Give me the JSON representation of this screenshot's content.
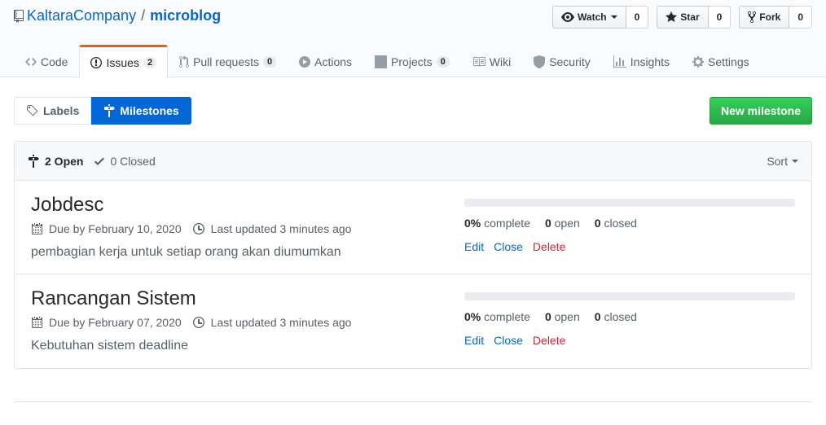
{
  "repo": {
    "owner": "KaltaraCompany",
    "separator": "/",
    "name": "microblog"
  },
  "actions": {
    "watch": {
      "label": "Watch",
      "count": "0"
    },
    "star": {
      "label": "Star",
      "count": "0"
    },
    "fork": {
      "label": "Fork",
      "count": "0"
    }
  },
  "nav": [
    {
      "label": "Code",
      "icon": "code-icon"
    },
    {
      "label": "Issues",
      "icon": "issue-icon",
      "counter": "2"
    },
    {
      "label": "Pull requests",
      "icon": "pull-request-icon",
      "counter": "0"
    },
    {
      "label": "Actions",
      "icon": "play-icon"
    },
    {
      "label": "Projects",
      "icon": "project-icon",
      "counter": "0"
    },
    {
      "label": "Wiki",
      "icon": "book-icon"
    },
    {
      "label": "Security",
      "icon": "shield-icon"
    },
    {
      "label": "Insights",
      "icon": "graph-icon"
    },
    {
      "label": "Settings",
      "icon": "gear-icon"
    }
  ],
  "subnav": {
    "labels": "Labels",
    "milestones": "Milestones"
  },
  "new_milestone": "New milestone",
  "filter": {
    "open": "2 Open",
    "closed": "0 Closed",
    "sort": "Sort"
  },
  "milestones": [
    {
      "title": "Jobdesc",
      "due": "Due by February 10, 2020",
      "updated": "Last updated 3 minutes ago",
      "description": "pembagian kerja untuk setiap orang akan diumumkan",
      "percent": "0%",
      "percent_label": "complete",
      "open": "0",
      "open_label": "open",
      "closed": "0",
      "closed_label": "closed",
      "progress": 0,
      "edit": "Edit",
      "close": "Close",
      "delete": "Delete"
    },
    {
      "title": "Rancangan Sistem",
      "due": "Due by February 07, 2020",
      "updated": "Last updated 3 minutes ago",
      "description": "Kebutuhan sistem deadline",
      "percent": "0%",
      "percent_label": "complete",
      "open": "0",
      "open_label": "open",
      "closed": "0",
      "closed_label": "closed",
      "progress": 0,
      "edit": "Edit",
      "close": "Close",
      "delete": "Delete"
    }
  ],
  "colors": {
    "link": "#0366d6",
    "accent_tab": "#e36209",
    "primary_button": "#28a745",
    "danger": "#cb2431"
  }
}
